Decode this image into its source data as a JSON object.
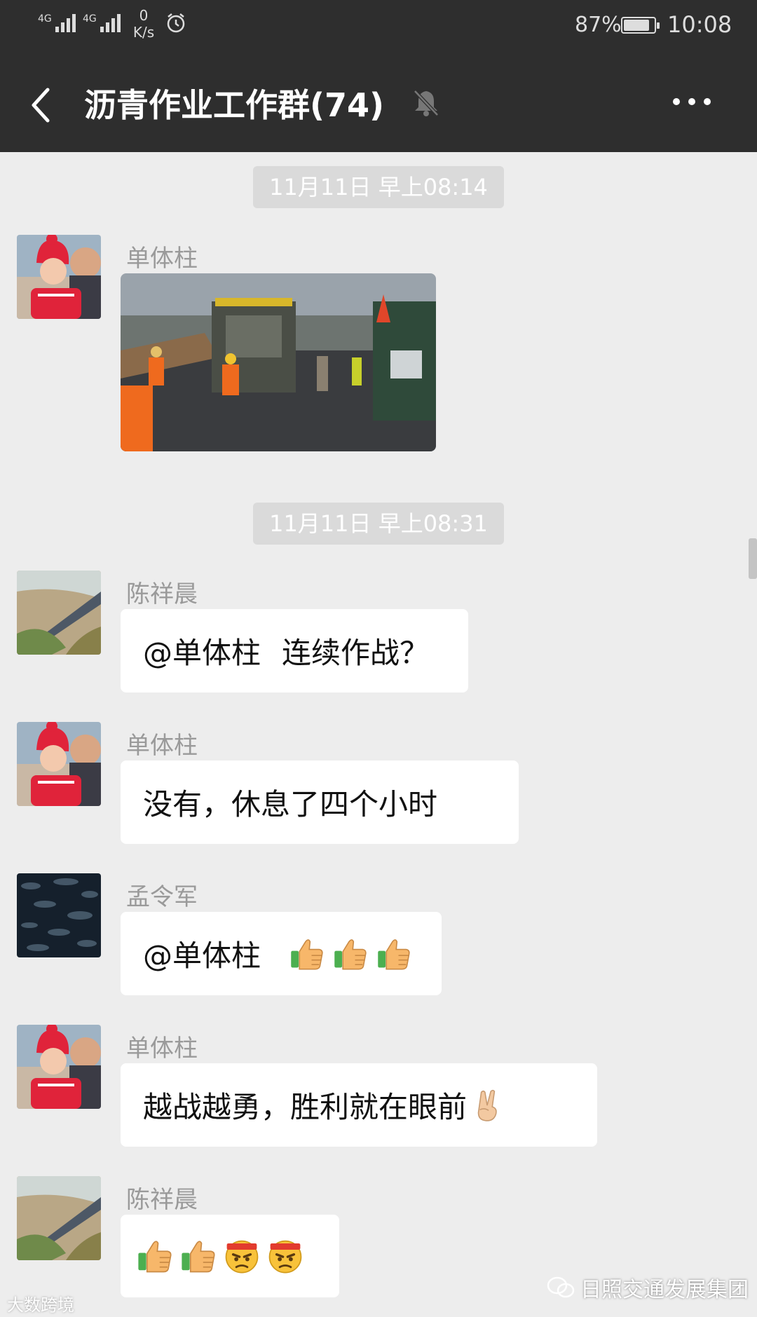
{
  "status_bar": {
    "signal_1_label": "4G",
    "signal_2_label": "4G",
    "net_speed_value": "0",
    "net_speed_unit": "K/s",
    "battery_percent": "87%",
    "battery_level": 0.87,
    "time": "10:08"
  },
  "header": {
    "title": "沥青作业工作群(74)",
    "icons": [
      "back-arrow-icon",
      "mute-bell-icon",
      "more-icon"
    ]
  },
  "timestamps": [
    "11月11日 早上08:14",
    "11月11日 早上08:31"
  ],
  "messages": [
    {
      "sender": "单体柱",
      "type": "image",
      "avatar": "baby-red-hat"
    },
    {
      "sender": "陈祥晨",
      "type": "text",
      "text_1": "@单体柱",
      "text_2": "连续作战？",
      "avatar": "highway-aerial"
    },
    {
      "sender": "单体柱",
      "type": "text",
      "text": "没有，休息了四个小时",
      "avatar": "baby-red-hat"
    },
    {
      "sender": "孟令军",
      "type": "text",
      "text": "@单体柱",
      "emojis": [
        "thumbs-up",
        "thumbs-up",
        "thumbs-up"
      ],
      "avatar": "night-sky"
    },
    {
      "sender": "单体柱",
      "type": "text",
      "text": "越战越勇，胜利就在眼前",
      "emojis": [
        "victory-hand"
      ],
      "avatar": "baby-red-hat"
    },
    {
      "sender": "陈祥晨",
      "type": "text",
      "emojis": [
        "thumbs-up",
        "thumbs-up",
        "determined-face",
        "determined-face"
      ],
      "avatar": "highway-aerial"
    }
  ],
  "watermarks": {
    "left": "大数跨境",
    "right": "日照交通发展集团"
  },
  "colors": {
    "header_bg": "#2e2e2e",
    "chat_bg": "#ededed",
    "bubble_bg": "#ffffff",
    "timestamp_bg": "#dadada"
  }
}
